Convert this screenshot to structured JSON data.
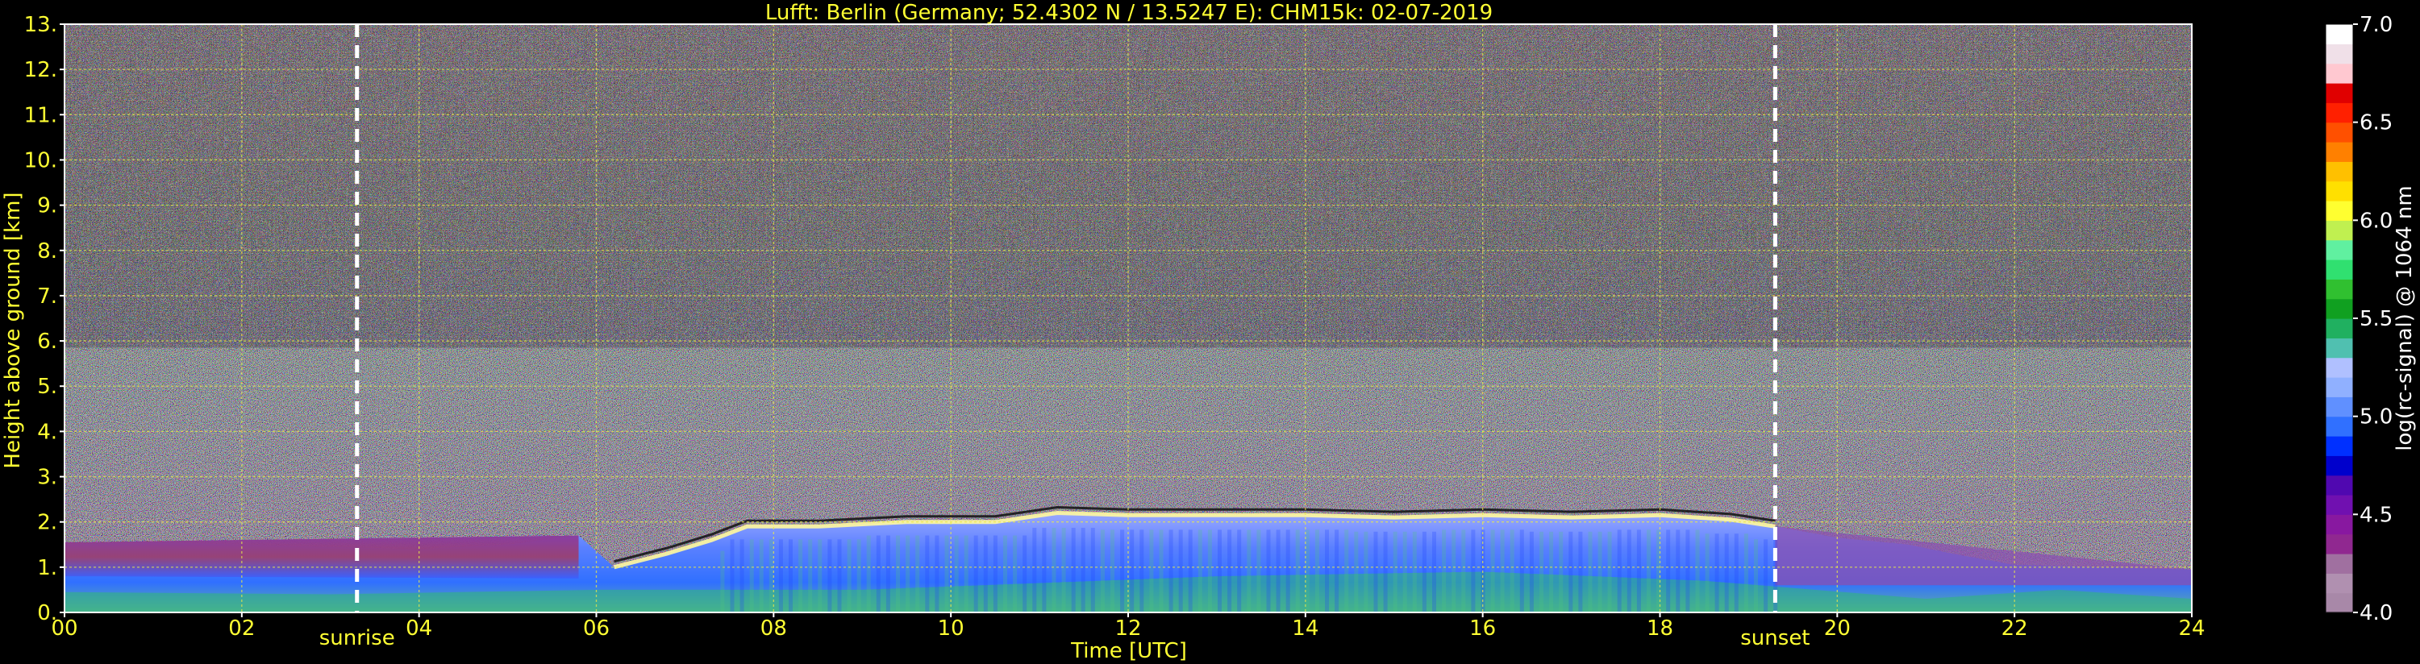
{
  "chart_data": {
    "type": "heatmap",
    "title": "Lufft: Berlin (Germany; 52.4302 N / 13.5247 E):    CHM15k: 02-07-2019",
    "xlabel": "Time [UTC]",
    "ylabel": "Height above ground [km]",
    "xlim": [
      0,
      24
    ],
    "ylim": [
      0,
      13
    ],
    "x_ticks": [
      "00",
      "02",
      "04",
      "06",
      "08",
      "10",
      "12",
      "14",
      "16",
      "18",
      "20",
      "22",
      "24"
    ],
    "y_ticks": [
      "0.",
      "1.",
      "2.",
      "3.",
      "4.",
      "5.",
      "6.",
      "7.",
      "8.",
      "9.",
      "10.",
      "11.",
      "12.",
      "13."
    ],
    "grid": true,
    "markers": [
      {
        "label": "sunrise",
        "x": 3.3
      },
      {
        "label": "sunset",
        "x": 19.3
      }
    ],
    "colorbar": {
      "label": "log(rc-signal) @ 1064 nm",
      "range": [
        4.0,
        7.0
      ],
      "ticks": [
        "4.0",
        "4.5",
        "5.0",
        "5.5",
        "6.0",
        "6.5",
        "7.0"
      ],
      "colors": [
        "#a888a8",
        "#b090b0",
        "#a070a0",
        "#902890",
        "#8818a0",
        "#7010b0",
        "#5008b0",
        "#0000cc",
        "#0030ff",
        "#3070ff",
        "#6090ff",
        "#90b0ff",
        "#b0c0ff",
        "#50c0b0",
        "#20b060",
        "#10a020",
        "#30c030",
        "#30e070",
        "#60f0a0",
        "#c0f050",
        "#ffff30",
        "#ffe000",
        "#ffc000",
        "#ff8000",
        "#ff5000",
        "#ff2000",
        "#e00000",
        "#ffc8d0",
        "#f0e0e8",
        "#ffffff"
      ]
    },
    "layers": {
      "boundary_layer_top_km": [
        [
          0,
          1.5
        ],
        [
          1,
          1.55
        ],
        [
          2,
          1.5
        ],
        [
          3,
          1.45
        ],
        [
          4,
          1.4
        ],
        [
          5,
          1.5
        ],
        [
          5.8,
          1.7
        ],
        [
          6.2,
          1.0
        ],
        [
          6.8,
          1.3
        ],
        [
          7.3,
          1.6
        ],
        [
          7.7,
          1.9
        ],
        [
          8.5,
          1.9
        ],
        [
          9.5,
          2.0
        ],
        [
          10.5,
          2.0
        ],
        [
          11.2,
          2.2
        ],
        [
          12,
          2.15
        ],
        [
          13,
          2.15
        ],
        [
          14,
          2.15
        ],
        [
          15,
          2.1
        ],
        [
          16,
          2.15
        ],
        [
          17,
          2.1
        ],
        [
          18,
          2.15
        ],
        [
          18.8,
          2.05
        ],
        [
          19.3,
          1.9
        ],
        [
          20,
          1.65
        ],
        [
          20.8,
          1.5
        ],
        [
          21.3,
          1.3
        ],
        [
          22,
          1.05
        ],
        [
          23,
          1.0
        ],
        [
          24,
          0.95
        ]
      ]
    }
  }
}
